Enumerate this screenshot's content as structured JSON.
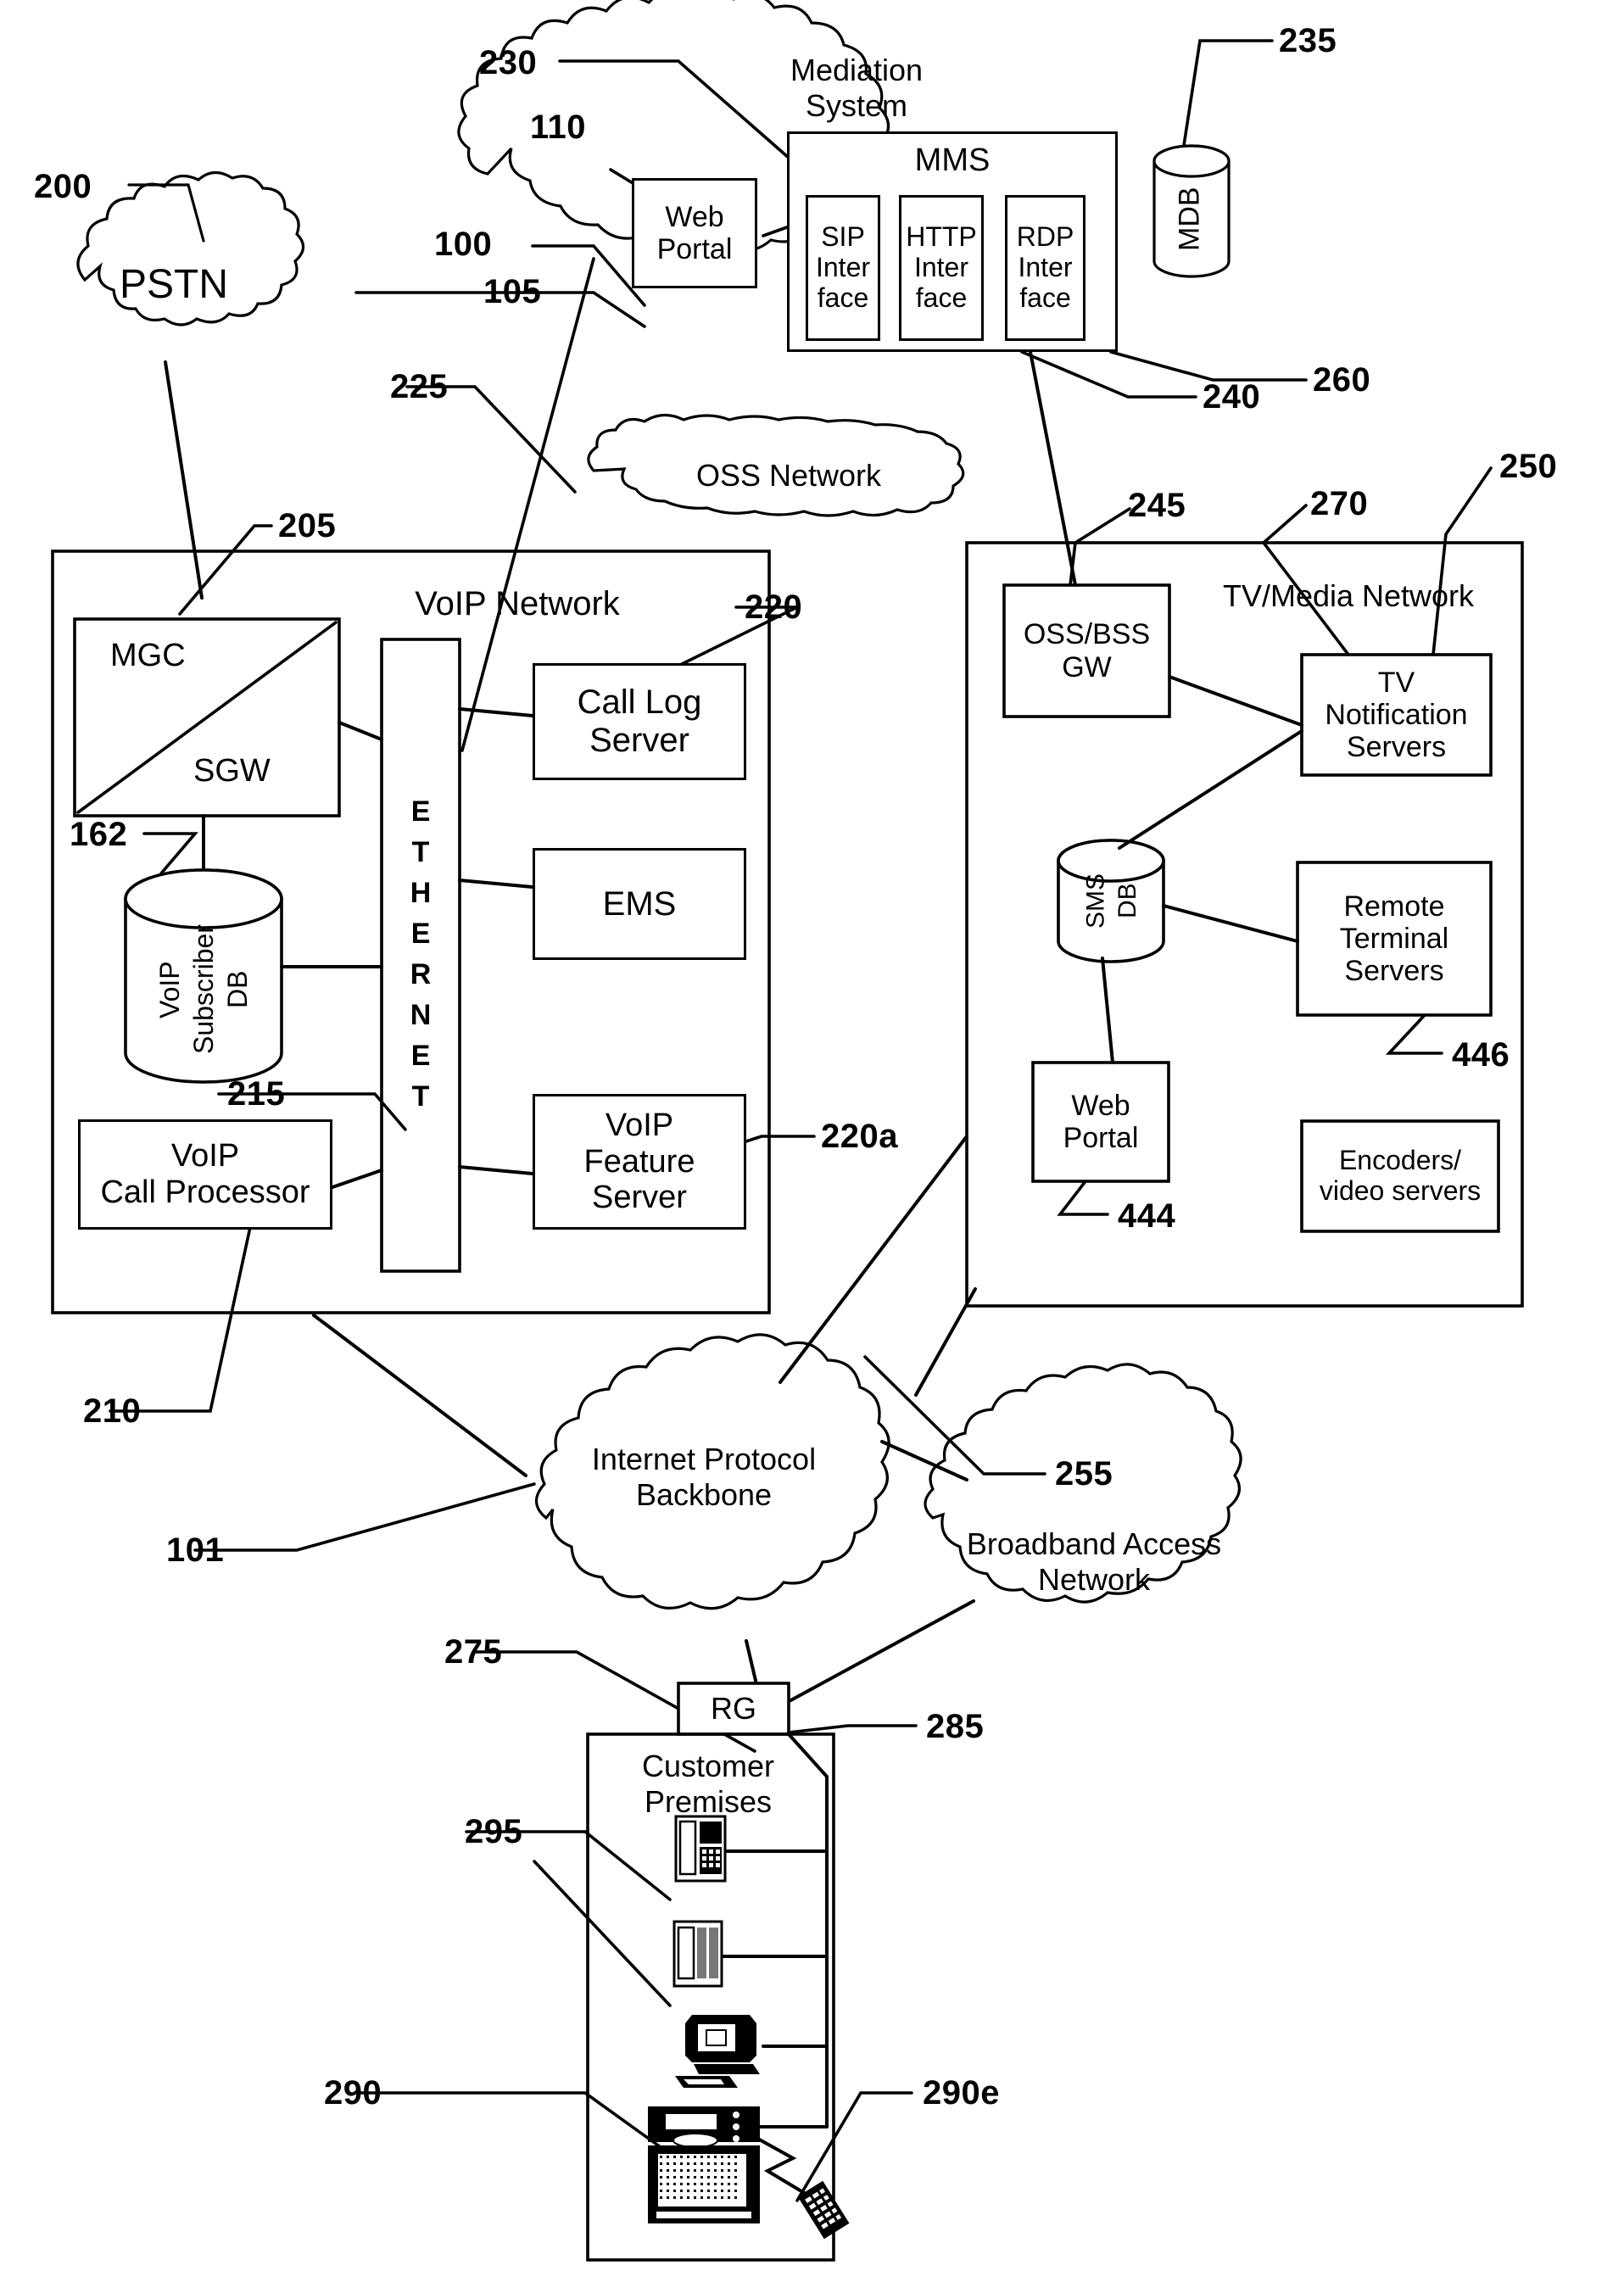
{
  "figure": {
    "type": "patent-network-diagram",
    "title": "Telecommunications network architecture diagram"
  },
  "clouds": [
    {
      "id": "pstn",
      "label": "PSTN",
      "ref": "200"
    },
    {
      "id": "mediation",
      "label": "Mediation\nSystem",
      "ref": "230"
    },
    {
      "id": "oss_network",
      "label": "OSS Network",
      "ref": "225"
    },
    {
      "id": "ip_backbone",
      "label": "Internet Protocol\nBackbone",
      "ref": "101"
    },
    {
      "id": "broadband",
      "label": "Broadband Access\nNetwork",
      "ref": "255"
    }
  ],
  "mediation_system": {
    "web_portal": {
      "label": "Web\nPortal",
      "ref": "110"
    },
    "mms": {
      "label": "MMS",
      "ref": "240"
    },
    "interfaces": [
      {
        "label": "SIP\nInter\nface",
        "ref": "105"
      },
      {
        "label": "HTTP\nInter\nface",
        "ref": "260"
      },
      {
        "label": "RDP\nInter\nface",
        "ref": ""
      }
    ],
    "mdb": {
      "label": "MDB",
      "ref": "235"
    },
    "outer_ref": "100"
  },
  "voip_network": {
    "title": "VoIP Network",
    "ref": "205",
    "mgc_sgw": {
      "top_label": "MGC",
      "bottom_label": "SGW"
    },
    "subscriber_db": {
      "label": "VoIP\nSubscriber\nDB",
      "ref": "162"
    },
    "ethernet": {
      "label": "ETHERNET",
      "ref": "215"
    },
    "call_processor": {
      "label": "VoIP\nCall Processor",
      "ref": "210"
    },
    "boxes": [
      {
        "label": "Call Log\nServer",
        "ref": "220"
      },
      {
        "label": "EMS",
        "ref": ""
      },
      {
        "label": "VoIP\nFeature\nServer",
        "ref": "220a"
      }
    ]
  },
  "tv_media_network": {
    "title": "TV/Media Network",
    "ref": "250",
    "oss_bss_gw": {
      "label": "OSS/BSS\nGW",
      "ref": "245"
    },
    "tv_notification": {
      "label": "TV\nNotification\nServers",
      "ref": "270"
    },
    "sms_db": {
      "label": "SMS\nDB",
      "ref": ""
    },
    "remote_terminal": {
      "label": "Remote\nTerminal\nServers",
      "ref": "446"
    },
    "web_portal": {
      "label": "Web\nPortal",
      "ref": "444"
    },
    "encoders": {
      "label": "Encoders/\nvideo servers",
      "ref": ""
    }
  },
  "customer_premises": {
    "title": "Customer\nPremises",
    "ref": "275",
    "rg": {
      "label": "RG",
      "ref": "285"
    },
    "devices": [
      {
        "name": "phone-1",
        "ref": "295"
      },
      {
        "name": "phone-2",
        "ref": ""
      },
      {
        "name": "computer",
        "ref": ""
      },
      {
        "name": "television",
        "ref": "290"
      },
      {
        "name": "remote-control",
        "ref": "290e"
      }
    ]
  },
  "reference_numbers": [
    "100",
    "101",
    "105",
    "110",
    "162",
    "200",
    "205",
    "210",
    "215",
    "220",
    "220a",
    "225",
    "230",
    "235",
    "240",
    "245",
    "250",
    "255",
    "260",
    "270",
    "275",
    "285",
    "290",
    "290e",
    "295",
    "444",
    "446"
  ],
  "colors": {
    "stroke": "#000000",
    "fill": "#ffffff"
  }
}
